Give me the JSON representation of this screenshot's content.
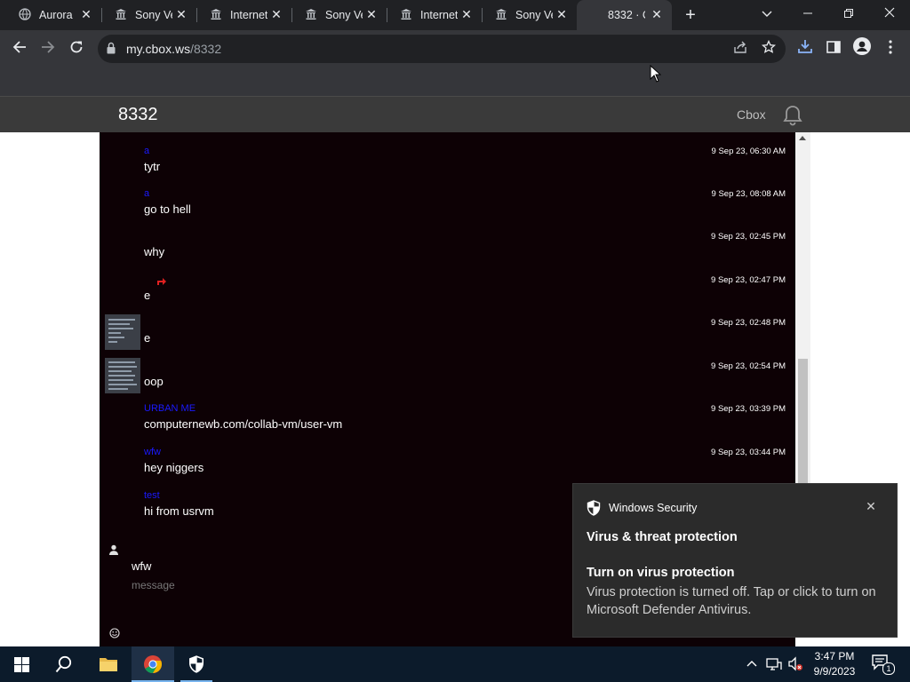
{
  "browser": {
    "tabs": [
      {
        "title": "Aurora",
        "active": false
      },
      {
        "title": "Sony Ve",
        "active": false
      },
      {
        "title": "Internet",
        "active": false
      },
      {
        "title": "Sony Ve",
        "active": false
      },
      {
        "title": "Internet",
        "active": false
      },
      {
        "title": "Sony Ve",
        "active": false
      },
      {
        "title": "8332 · C",
        "active": true
      }
    ],
    "url_host": "my.cbox.ws",
    "url_path": "/8332"
  },
  "cbox": {
    "title": "8332",
    "link": "Cbox"
  },
  "messages": [
    {
      "name": "a",
      "text": "tytr",
      "time": "9 Sep 23, 06:30 AM",
      "avatar": false
    },
    {
      "name": "a",
      "text": "go to hell",
      "time": "9 Sep 23, 08:08 AM",
      "avatar": false
    },
    {
      "name": "",
      "text": "why",
      "time": "9 Sep 23, 02:45 PM",
      "avatar": false
    },
    {
      "name": "",
      "text": "e",
      "time": "9 Sep 23, 02:47 PM",
      "avatar": false,
      "redicon": true
    },
    {
      "name": "",
      "text": "e",
      "time": "9 Sep 23, 02:48 PM",
      "avatar": true
    },
    {
      "name": "",
      "text": "oop",
      "time": "9 Sep 23, 02:54 PM",
      "avatar": true
    },
    {
      "name": "URBAN ME",
      "text": "computernewb.com/collab-vm/user-vm",
      "time": "9 Sep 23, 03:39 PM",
      "avatar": false
    },
    {
      "name": "wfw",
      "text": "hey niggers",
      "time": "9 Sep 23, 03:44 PM",
      "avatar": false
    },
    {
      "name": "test",
      "text": "hi from usrvm",
      "time": "",
      "avatar": false
    }
  ],
  "compose": {
    "username": "wfw",
    "placeholder": "message"
  },
  "toast": {
    "app": "Windows Security",
    "title": "Virus & threat protection",
    "subtitle": "Turn on virus protection",
    "body": "Virus protection is turned off. Tap or click to turn on Microsoft Defender Antivirus."
  },
  "taskbar": {
    "time": "3:47 PM",
    "date": "9/9/2023",
    "notification_count": "1"
  },
  "colors": {
    "chat_bg": "#0d0105",
    "name_blue": "#1a1aff",
    "accent_windows": "#78b4ee"
  }
}
